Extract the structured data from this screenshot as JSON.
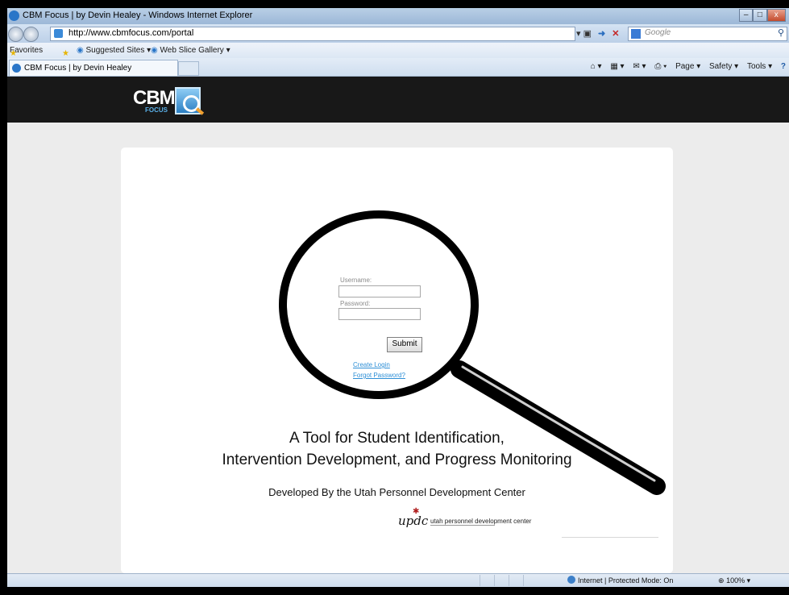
{
  "window": {
    "title": "CBM Focus | by Devin Healey - Windows Internet Explorer",
    "controls": {
      "minimize": "–",
      "maximize": "□",
      "close": "x"
    }
  },
  "address_bar": {
    "url": "http://www.cbmfocus.com/portal",
    "search_placeholder": "Google"
  },
  "favorites_bar": {
    "favorites_label": "Favorites",
    "suggested_sites": "Suggested Sites ▾",
    "web_slice_gallery": "Web Slice Gallery ▾"
  },
  "tab": {
    "title": "CBM Focus | by Devin Healey"
  },
  "command_bar": {
    "page": "Page ▾",
    "safety": "Safety ▾",
    "tools": "Tools ▾",
    "help": "?"
  },
  "page": {
    "logo_text": "CBM",
    "logo_subtext": "FOCUS",
    "login": {
      "username_label": "Username:",
      "password_label": "Password:",
      "username_value": "",
      "password_value": "",
      "submit_label": "Submit",
      "create_login": "Create Login",
      "forgot_password": "Forgot Password?"
    },
    "tagline_line1": "A Tool for Student Identification,",
    "tagline_line2": "Intervention Development, and Progress Monitoring",
    "developed_by": "Developed By the Utah Personnel Development Center",
    "updc_mark": "updc",
    "updc_name": "utah personnel development center"
  },
  "status_bar": {
    "zone": "Internet | Protected Mode: On",
    "zoom": "100%"
  },
  "colors": {
    "header_bg": "#181818",
    "page_bg": "#ececec",
    "link": "#2e8fd6",
    "ie_frame": "#bcd0e8"
  }
}
